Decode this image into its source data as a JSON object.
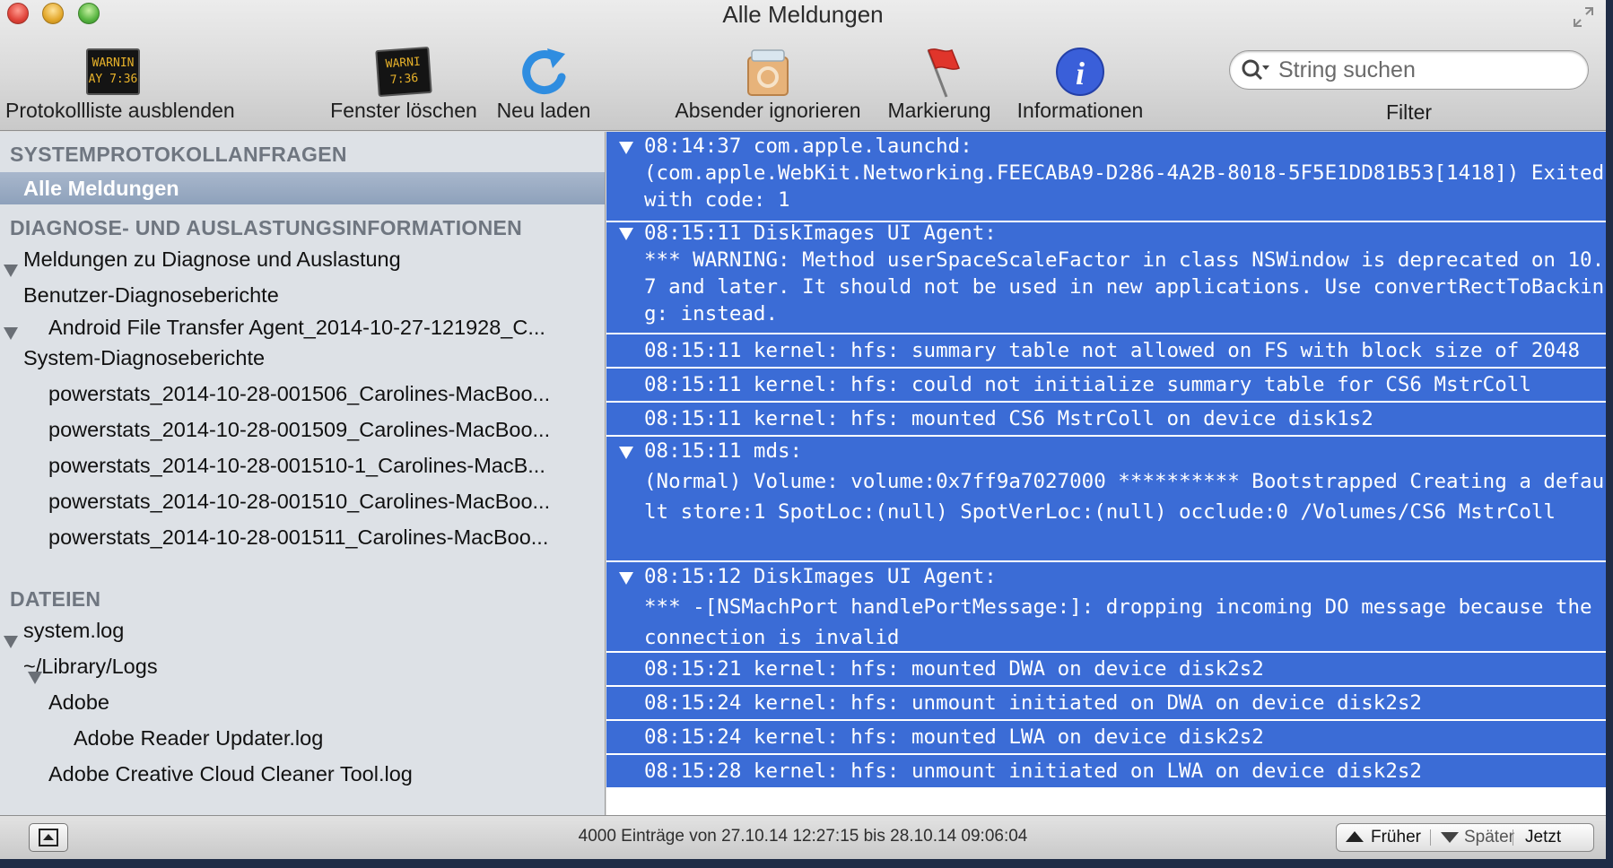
{
  "window": {
    "title": "Alle Meldungen"
  },
  "toolbar": {
    "hide_log_list": "Protokollliste ausblenden",
    "clear_window": "Fenster löschen",
    "reload": "Neu laden",
    "ignore_sender": "Absender ignorieren",
    "mark": "Markierung",
    "info": "Informationen",
    "console_icon_text": [
      "WARNIN",
      "AY 7:36"
    ],
    "clear_icon_text": [
      "WARNI",
      "7:36"
    ]
  },
  "search": {
    "placeholder": "String suchen",
    "value": "",
    "filter_label": "Filter"
  },
  "sidebar": {
    "section_system": "SYSTEMPROTOKOLLANFRAGEN",
    "all_messages": "Alle Meldungen",
    "section_diagnostics": "DIAGNOSE- UND AUSLASTUNGSINFORMATIONEN",
    "diag_messages": "Meldungen zu Diagnose und Auslastung",
    "user_reports": "Benutzer-Diagnoseberichte",
    "user_report_items": [
      "Android File Transfer Agent_2014-10-27-121928_C..."
    ],
    "system_reports": "System-Diagnoseberichte",
    "system_report_items": [
      "powerstats_2014-10-28-001506_Carolines-MacBoo...",
      "powerstats_2014-10-28-001509_Carolines-MacBoo...",
      "powerstats_2014-10-28-001510-1_Carolines-MacB...",
      "powerstats_2014-10-28-001510_Carolines-MacBoo...",
      "powerstats_2014-10-28-001511_Carolines-MacBoo..."
    ],
    "section_files": "DATEIEN",
    "system_log": "system.log",
    "library_logs": "~/Library/Logs",
    "adobe": "Adobe",
    "adobe_reader_log": "Adobe Reader Updater.log",
    "adobe_cc_log": "Adobe Creative Cloud Cleaner Tool.log"
  },
  "log_entries": [
    {
      "lines": [
        "08:14:37 com.apple.launchd:",
        "(com.apple.WebKit.Networking.FEECABA9-D286-4A2B-8018-5F5E1DD81B53[1418]) Exited",
        "with code: 1"
      ]
    },
    {
      "lines": [
        "08:15:11 DiskImages UI Agent:",
        "*** WARNING: Method userSpaceScaleFactor in class NSWindow is deprecated on 10.",
        "7 and later. It should not be used in new applications. Use convertRectToBackin",
        "g: instead."
      ]
    },
    {
      "lines": [
        "08:15:11 kernel: hfs: summary table not allowed on FS with block size of 2048"
      ]
    },
    {
      "lines": [
        "08:15:11 kernel: hfs: could not initialize summary table for CS6 MstrColl"
      ]
    },
    {
      "lines": [
        "08:15:11 kernel: hfs: mounted CS6 MstrColl on device disk1s2"
      ]
    },
    {
      "lines": [
        "08:15:11 mds:",
        "(Normal) Volume: volume:0x7ff9a7027000 ********** Bootstrapped Creating a defau",
        "lt store:1 SpotLoc:(null) SpotVerLoc:(null) occlude:0 /Volumes/CS6 MstrColl"
      ]
    },
    {
      "lines": [
        "08:15:12 DiskImages UI Agent:",
        "*** -[NSMachPort handlePortMessage:]: dropping incoming DO message because the",
        "connection is invalid"
      ]
    },
    {
      "lines": [
        "08:15:21 kernel: hfs: mounted DWA on device disk2s2"
      ]
    },
    {
      "lines": [
        "08:15:24 kernel: hfs: unmount initiated on DWA on device disk2s2"
      ]
    },
    {
      "lines": [
        "08:15:24 kernel: hfs: mounted LWA on device disk2s2"
      ]
    },
    {
      "lines": [
        "08:15:28 kernel: hfs: unmount initiated on LWA on device disk2s2"
      ]
    }
  ],
  "status": {
    "text": "4000 Einträge von 27.10.14 12:27:15 bis 28.10.14 09:06:04",
    "earlier": "Früher",
    "later": "Später",
    "now": "Jetzt"
  },
  "colors": {
    "selection_blue": "#3b6cd6",
    "sidebar_bg": "#dde1e6",
    "section_gray": "#6f7680"
  }
}
